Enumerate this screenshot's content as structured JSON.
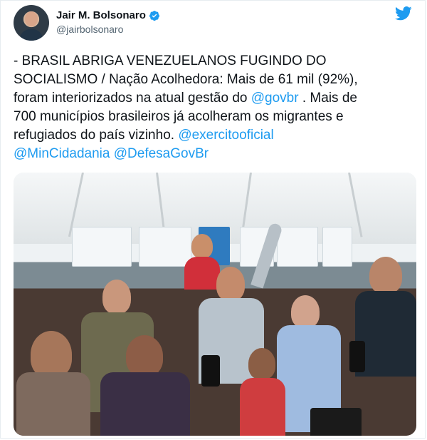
{
  "user": {
    "display_name": "Jair M. Bolsonaro",
    "handle": "@jairbolsonaro",
    "verified_icon": "verified-badge-icon",
    "brand_icon": "twitter-bird-icon"
  },
  "tweet": {
    "lines": [
      {
        "text": "- BRASIL ABRIGA VENEZUELANOS FUGINDO DO"
      },
      {
        "text": "SOCIALISMO / Nação Acolhedora: Mais de 61 mil (92%),"
      },
      {
        "text": "foram interiorizados na atual gestão do ",
        "link": "@govbr",
        "after": " . Mais de"
      },
      {
        "text": "700 municípios brasileiros já acolheram os migrantes e"
      },
      {
        "text": "refugiados do país vizinho. ",
        "link": "@exercitooficial",
        "after": ""
      },
      {
        "text": "",
        "link": "@MinCidadania",
        "between": " ",
        "link2": "@DefesaGovBr"
      }
    ]
  },
  "media": {
    "caption": "photo"
  },
  "colors": {
    "link": "#1d9bf0",
    "verified": "#1d9bf0",
    "twitter": "#1d9bf0"
  }
}
